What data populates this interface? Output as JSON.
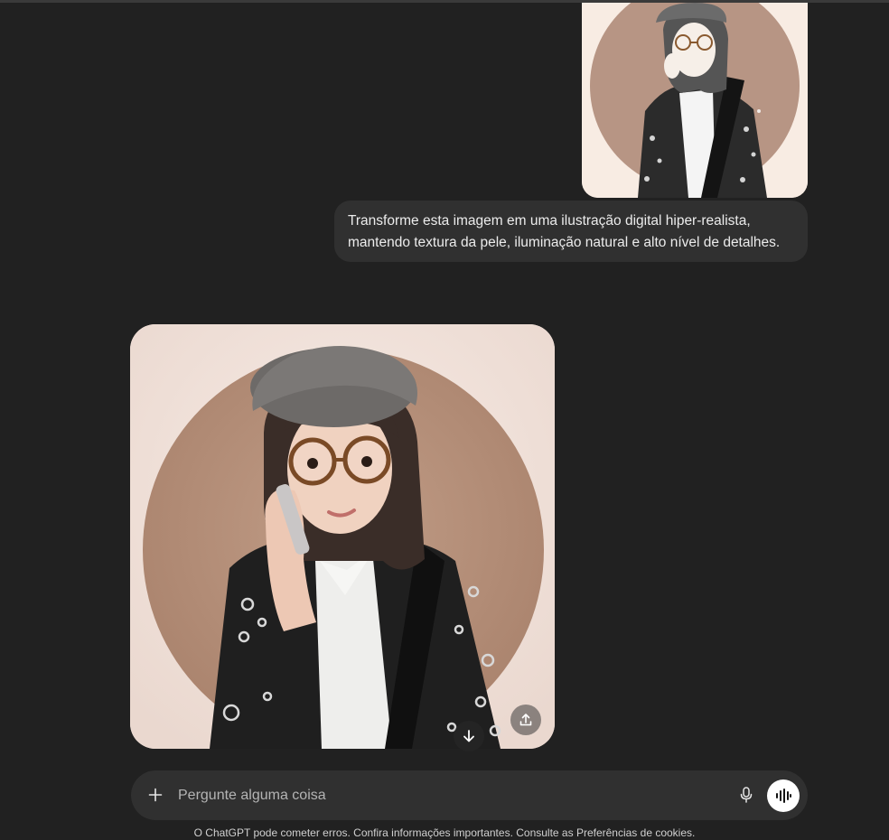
{
  "conversation": {
    "user_message": {
      "line1": "Transforme esta imagem em uma ilustração digital hiper-realista,",
      "line2": "mantendo textura da pele, iluminação natural e alto nível de detalhes."
    }
  },
  "image_actions": {
    "download_icon": "arrow-down-icon",
    "share_icon": "upload-icon"
  },
  "composer": {
    "placeholder": "Pergunte alguma coisa",
    "plus_icon": "plus-icon",
    "mic_icon": "microphone-icon",
    "voice_icon": "voice-waveform-icon"
  },
  "footer": {
    "text": "O ChatGPT pode cometer erros. Confira informações importantes. Consulte as Preferências de cookies."
  },
  "colors": {
    "background": "#212121",
    "bubble": "#303030",
    "composer": "#303030"
  }
}
